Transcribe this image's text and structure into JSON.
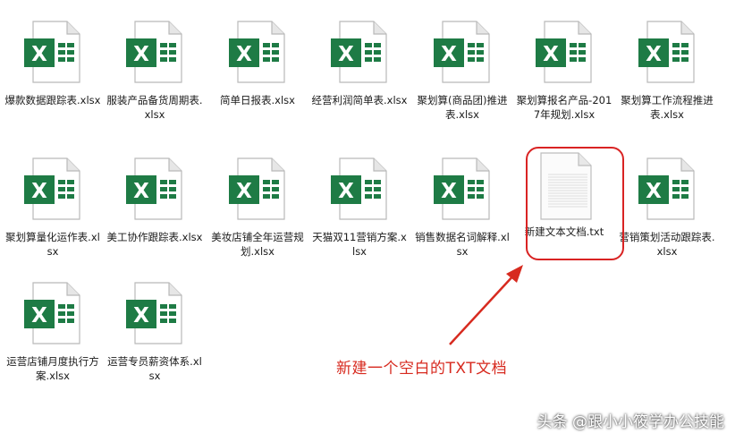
{
  "files": [
    {
      "name": "爆款数据跟踪表.xlsx",
      "type": "excel"
    },
    {
      "name": "服装产品备货周期表.xlsx",
      "type": "excel"
    },
    {
      "name": "简单日报表.xlsx",
      "type": "excel"
    },
    {
      "name": "经营利润简单表.xlsx",
      "type": "excel"
    },
    {
      "name": "聚划算(商品团)推进表.xlsx",
      "type": "excel"
    },
    {
      "name": "聚划算报名产品-2017年规划.xlsx",
      "type": "excel"
    },
    {
      "name": "聚划算工作流程推进表.xlsx",
      "type": "excel"
    },
    {
      "name": "聚划算量化运作表.xlsx",
      "type": "excel"
    },
    {
      "name": "美工协作跟踪表.xlsx",
      "type": "excel"
    },
    {
      "name": "美妆店铺全年运营规划.xlsx",
      "type": "excel"
    },
    {
      "name": "天猫双11营销方案.xlsx",
      "type": "excel"
    },
    {
      "name": "销售数据名词解释.xlsx",
      "type": "excel"
    },
    {
      "name": "新建文本文档.txt",
      "type": "text"
    },
    {
      "name": "营销策划活动跟踪表.xlsx",
      "type": "excel"
    },
    {
      "name": "运营店铺月度执行方案.xlsx",
      "type": "excel"
    },
    {
      "name": "运营专员薪资体系.xlsx",
      "type": "excel"
    }
  ],
  "annotation": "新建一个空白的TXT文档",
  "watermark": "头条 @跟小小筱学办公技能",
  "colors": {
    "excel_green": "#1e7b45",
    "highlight_red": "#d92323",
    "annotation_red": "#d72a1f"
  },
  "icons": {
    "excel": "excel-file-icon",
    "text": "text-file-icon"
  }
}
